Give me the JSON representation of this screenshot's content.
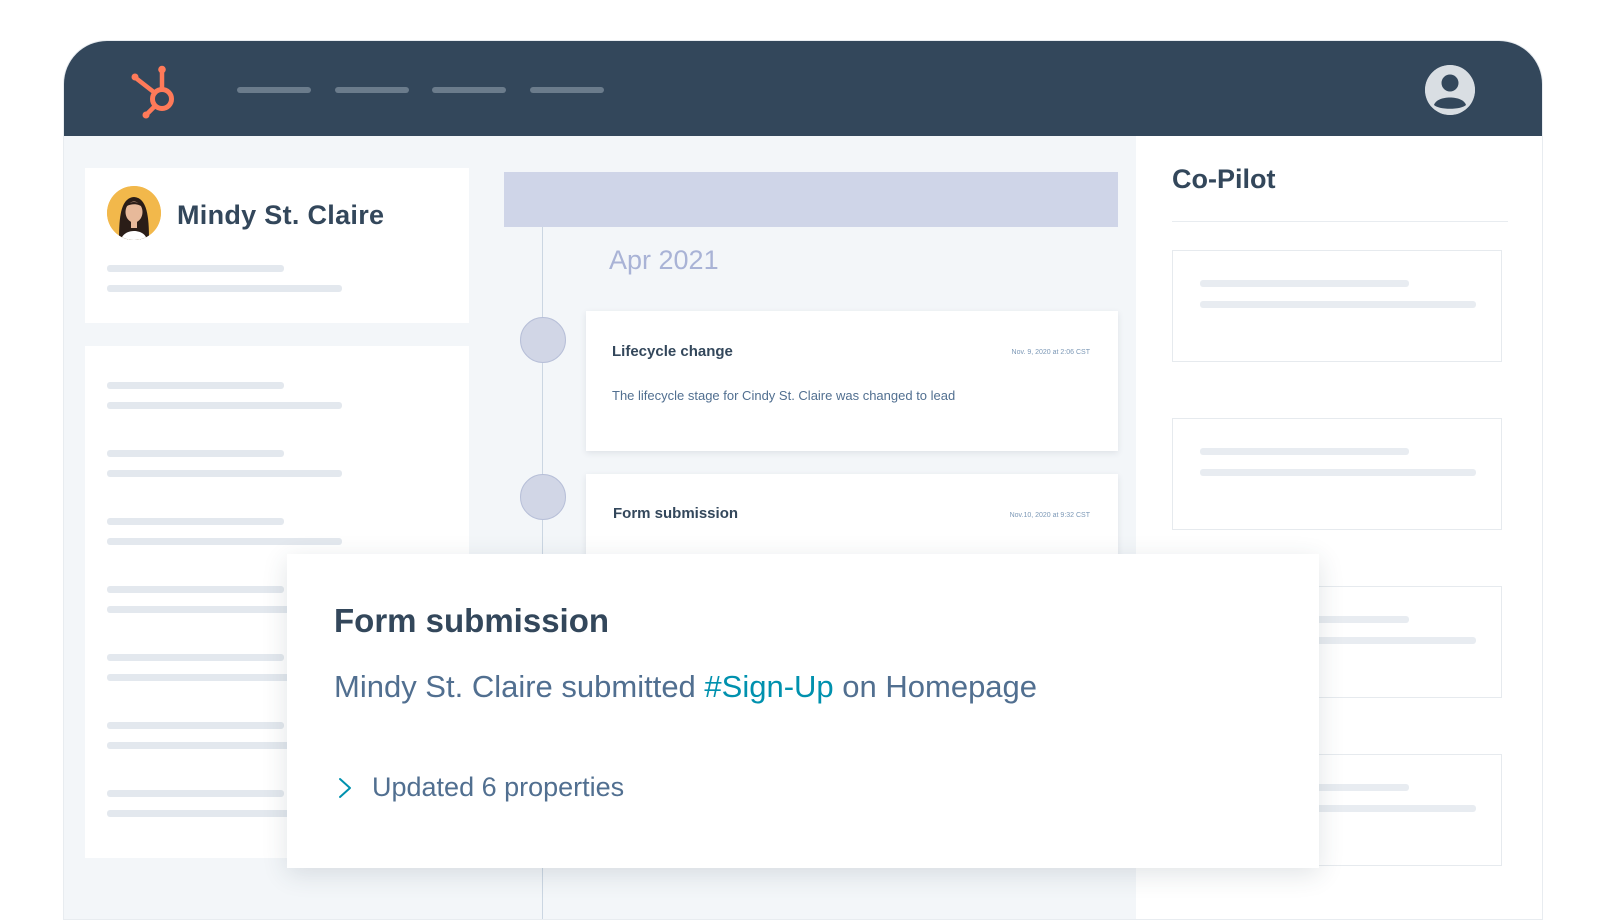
{
  "header": {
    "logo_icon": "hubspot-sprocket-icon",
    "nav_items": [
      "",
      "",
      "",
      ""
    ],
    "account_icon": "user-avatar-icon",
    "brand_color": "#ff7a59",
    "bar_color": "#33475b"
  },
  "contact": {
    "name": "Mindy St. Claire",
    "avatar_icon": "contact-photo"
  },
  "timeline": {
    "month": "Apr 2021",
    "events": [
      {
        "title": "Lifecycle change",
        "time": "Nov. 9, 2020 at 2:06 CST",
        "description": "The lifecycle stage for Cindy St. Claire was changed to lead"
      },
      {
        "title": "Form submission",
        "time": "Nov.10, 2020 at 9:32 CST",
        "description": ""
      }
    ]
  },
  "copilot": {
    "title": "Co-Pilot"
  },
  "popup": {
    "title": "Form submission",
    "desc_prefix": "Mindy St. Claire submitted ",
    "desc_link": "#Sign-Up",
    "desc_suffix": " on Homepage",
    "expand_label": "Updated 6 properties",
    "expand_icon": "chevron-right-icon",
    "link_color": "#0091ae"
  }
}
